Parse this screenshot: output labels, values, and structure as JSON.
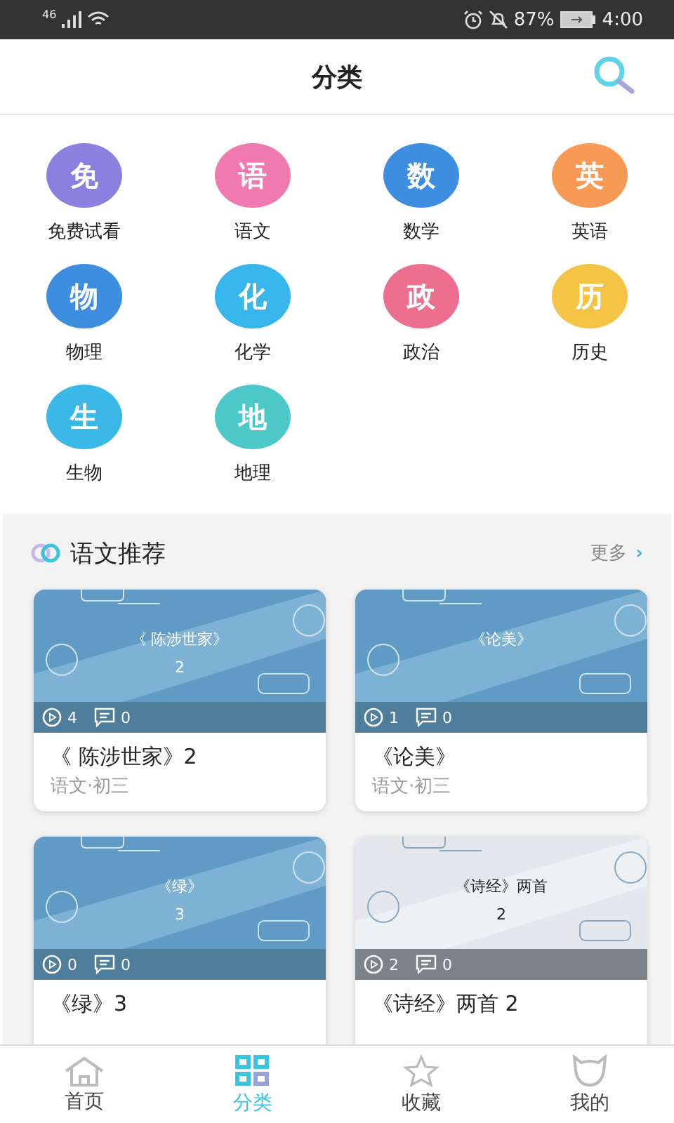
{
  "status_bar": {
    "network": "46",
    "battery": "87%",
    "time": "4:00"
  },
  "header": {
    "title": "分类"
  },
  "categories": [
    {
      "glyph": "免",
      "label": "免费试看",
      "color": "#8b7fe0"
    },
    {
      "glyph": "语",
      "label": "语文",
      "color": "#f07ab0"
    },
    {
      "glyph": "数",
      "label": "数学",
      "color": "#3d8de0"
    },
    {
      "glyph": "英",
      "label": "英语",
      "color": "#f89a55"
    },
    {
      "glyph": "物",
      "label": "物理",
      "color": "#3d8de0"
    },
    {
      "glyph": "化",
      "label": "化学",
      "color": "#36b6ea"
    },
    {
      "glyph": "政",
      "label": "政治",
      "color": "#ee6e8e"
    },
    {
      "glyph": "历",
      "label": "历史",
      "color": "#f5c444"
    },
    {
      "glyph": "生",
      "label": "生物",
      "color": "#3ab8e8"
    },
    {
      "glyph": "地",
      "label": "地理",
      "color": "#4cc8c8"
    }
  ],
  "section": {
    "title": "语文推荐",
    "more": "更多",
    "more_arrow": "›"
  },
  "cards": [
    {
      "kind": "blue",
      "cover_title": "《 陈涉世家》",
      "cover_sub": "2",
      "plays": "4",
      "comments": "0",
      "title": "《 陈涉世家》2",
      "subtitle": "语文·初三"
    },
    {
      "kind": "blue",
      "cover_title": "《论美》",
      "plays": "1",
      "comments": "0",
      "title": "《论美》",
      "subtitle": "语文·初三"
    },
    {
      "kind": "blue",
      "cover_title": "《绿》",
      "cover_sub": "3",
      "plays": "0",
      "comments": "0",
      "title": "《绿》3"
    },
    {
      "kind": "gray",
      "cover_title": "《诗经》两首",
      "cover_sub": "2",
      "plays": "2",
      "comments": "0",
      "title": "《诗经》两首 2"
    }
  ],
  "nav": [
    {
      "kind": "home",
      "label": "首页",
      "selected": false
    },
    {
      "kind": "grid",
      "label": "分类",
      "selected": true
    },
    {
      "kind": "star",
      "label": "收藏",
      "selected": false
    },
    {
      "kind": "cat",
      "label": "我的",
      "selected": false
    }
  ]
}
